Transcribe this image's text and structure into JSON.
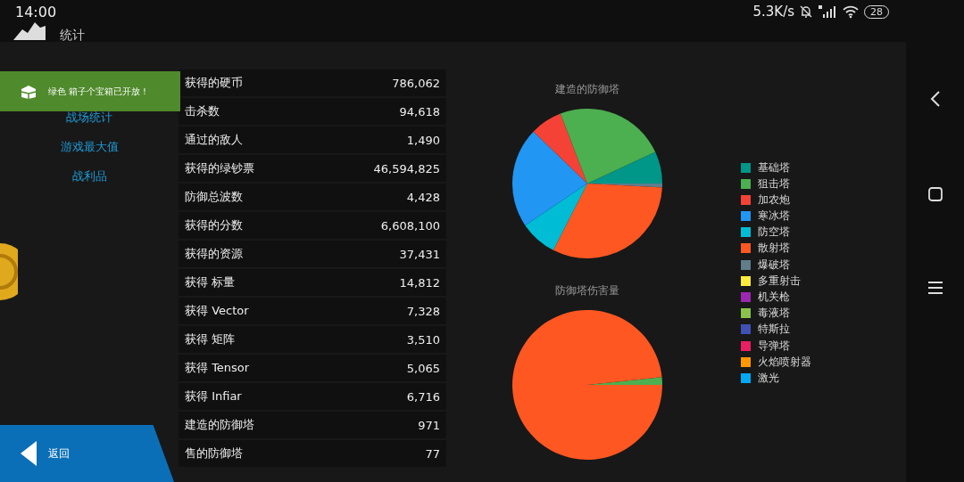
{
  "status_bar": {
    "time": "14:00",
    "net_speed": "5.3K/s",
    "battery": "28"
  },
  "header": {
    "title": "统计"
  },
  "sidebar": {
    "items": [
      {
        "label": "战场统计"
      },
      {
        "label": "游戏最大值"
      },
      {
        "label": "战利品"
      }
    ]
  },
  "toast": {
    "text": "绿色 箱子个宝箱已开放！"
  },
  "table": {
    "rows": [
      {
        "label": "获得的硬币",
        "value": "786,062"
      },
      {
        "label": "击杀数",
        "value": "94,618"
      },
      {
        "label": "通过的敌人",
        "value": "1,490"
      },
      {
        "label": "获得的绿钞票",
        "value": "46,594,825"
      },
      {
        "label": "防御总波数",
        "value": "4,428"
      },
      {
        "label": "获得的分数",
        "value": "6,608,100"
      },
      {
        "label": "获得的资源",
        "value": "37,431"
      },
      {
        "label": "获得 标量",
        "value": "14,812"
      },
      {
        "label": "获得 Vector",
        "value": "7,328"
      },
      {
        "label": "获得 矩阵",
        "value": "3,510"
      },
      {
        "label": "获得 Tensor",
        "value": "5,065"
      },
      {
        "label": "获得 Infiar",
        "value": "6,716"
      },
      {
        "label": "建造的防御塔",
        "value": "971"
      },
      {
        "label": "售的防御塔",
        "value": "77"
      }
    ]
  },
  "charts": [
    {
      "title": "建造的防御塔"
    },
    {
      "title": "防御塔伤害量"
    }
  ],
  "legend": [
    {
      "label": "基础塔",
      "color": "#009688"
    },
    {
      "label": "狙击塔",
      "color": "#4caf50"
    },
    {
      "label": "加农炮",
      "color": "#f44336"
    },
    {
      "label": "寒冰塔",
      "color": "#2196f3"
    },
    {
      "label": "防空塔",
      "color": "#00bcd4"
    },
    {
      "label": "散射塔",
      "color": "#ff5722"
    },
    {
      "label": "爆破塔",
      "color": "#607d8b"
    },
    {
      "label": "多重射击",
      "color": "#ffeb3b"
    },
    {
      "label": "机关枪",
      "color": "#9c27b0"
    },
    {
      "label": "毒液塔",
      "color": "#8bc34a"
    },
    {
      "label": "特斯拉",
      "color": "#3f51b5"
    },
    {
      "label": "导弹塔",
      "color": "#e91e63"
    },
    {
      "label": "火焰喷射器",
      "color": "#ff9800"
    },
    {
      "label": "激光",
      "color": "#03a9f4"
    }
  ],
  "back_button": {
    "label": "返回"
  }
}
